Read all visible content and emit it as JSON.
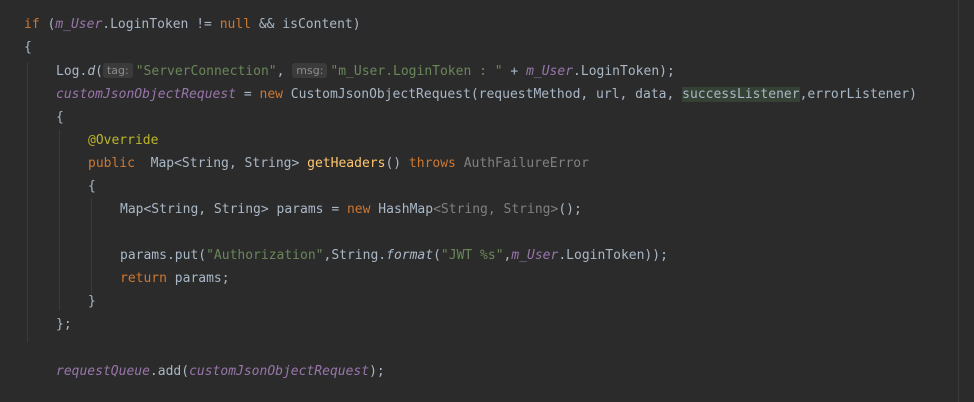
{
  "code": {
    "l1": {
      "kw_if": "if",
      "p1": " (",
      "user1": "m_User",
      "p2": ".LoginToken != ",
      "kw_null": "null",
      "p3": " && isContent)"
    },
    "l2": {
      "brace": "{"
    },
    "l3": {
      "p1": "Log.",
      "fn_d": "d",
      "p2": "(",
      "hint_tag": "tag:",
      "s1": "\"ServerConnection\"",
      "p3": ", ",
      "hint_msg": "msg:",
      "s2": "\"m_User.LoginToken : \"",
      "p4": " + ",
      "user": "m_User",
      "p5": ".LoginToken);"
    },
    "l4": {
      "var": "customJsonObjectRequest",
      "p1": " = ",
      "kw_new": "new",
      "p2": " CustomJsonObjectRequest(requestMethod, url, data, ",
      "hl": "successListener",
      "p3": ",errorListener)"
    },
    "l5": {
      "brace": "{"
    },
    "l6": {
      "ann": "@Override"
    },
    "l7": {
      "kw_public": "public",
      "p1": "  Map<String, String> ",
      "fn": "getHeaders",
      "p2": "() ",
      "kw_throws": "throws",
      "p3": " ",
      "gr": "AuthFailureError"
    },
    "l8": {
      "brace": "{"
    },
    "l9": {
      "p1": "Map<String, String> params = ",
      "kw_new": "new",
      "p2": " HashMap",
      "gr": "<String, String>",
      "p3": "();"
    },
    "l10": {
      "p1": "params.put(",
      "s1": "\"Authorization\"",
      "p2": ",String.",
      "fmt": "format",
      "p3": "(",
      "s2": "\"JWT %s\"",
      "p4": ",",
      "user": "m_User",
      "p5": ".LoginToken));"
    },
    "l11": {
      "kw_return": "return",
      "p1": " params;"
    },
    "l12": {
      "brace": "}"
    },
    "l13": {
      "p1": "};"
    },
    "l14": {
      "var": "requestQueue",
      "p1": ".add(",
      "var2": "customJsonObjectRequest",
      "p2": ");"
    }
  },
  "colors": {
    "background": "#2b2b2b",
    "text": "#a9b7c6",
    "keyword": "#cc7832",
    "string": "#6a8759",
    "field": "#9876aa",
    "function": "#ffc66d",
    "annotation": "#bbb529",
    "highlight": "#344134"
  }
}
